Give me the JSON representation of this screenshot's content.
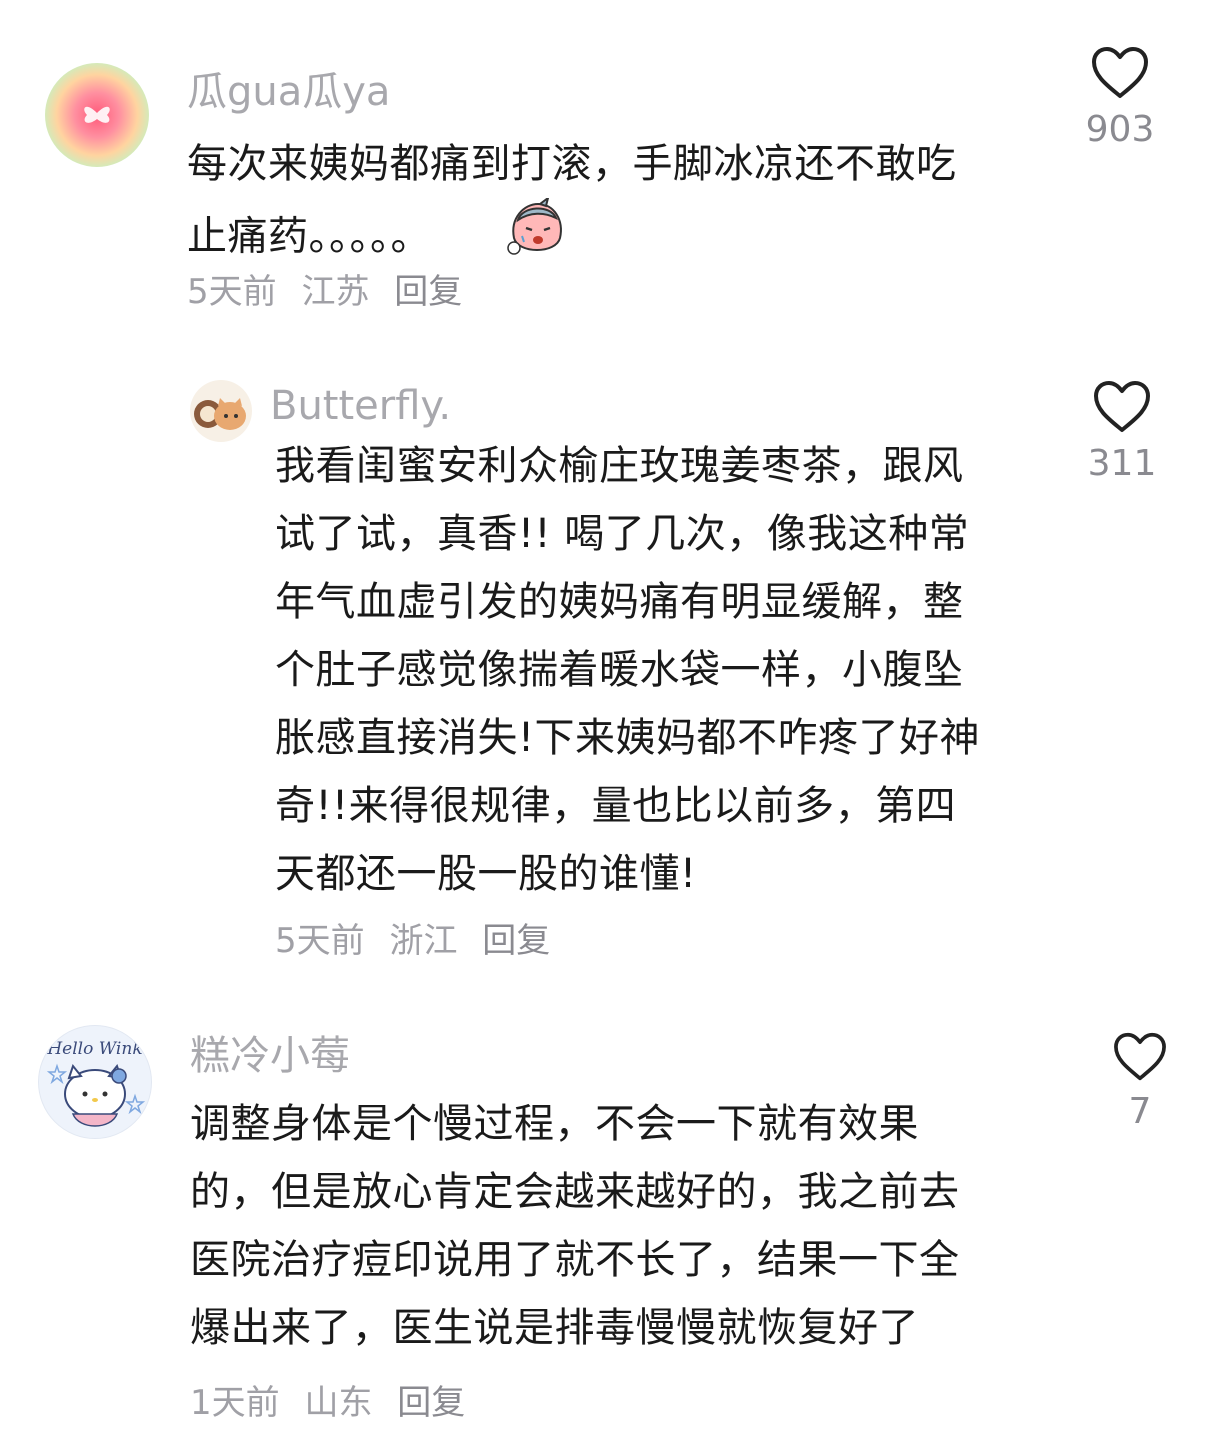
{
  "comments": [
    {
      "username": "瓜gua瓜ya",
      "text": "每次来姨妈都痛到打滚，手脚冰凉还不敢吃止痛药。。。。。",
      "line1": "每次来姨妈都痛到打滚，手脚冰凉还不敢吃",
      "line2": "止痛药。。。。。",
      "time": "5天前",
      "location": "江苏",
      "reply": "回复",
      "likes": "903"
    },
    {
      "username": "Butterfly.",
      "lines": [
        "我看闺蜜安利众榆庄玫瑰姜枣茶，跟风",
        "试了试，真香!! 喝了几次，像我这种常",
        "年气血虚引发的姨妈痛有明显缓解，整",
        "个肚子感觉像揣着暖水袋一样，小腹坠",
        "胀感直接消失!下来姨妈都不咋疼了好神",
        "奇!!来得很规律，量也比以前多，第四",
        "天都还一股一股的谁懂!"
      ],
      "time": "5天前",
      "location": "浙江",
      "reply": "回复",
      "likes": "311"
    },
    {
      "username": "糕冷小莓",
      "avatar_text": "Hello Wink",
      "lines": [
        "调整身体是个慢过程，不会一下就有效果",
        "的，但是放心肯定会越来越好的，我之前去",
        "医院治疗痘印说用了就不长了，结果一下全",
        "爆出来了，医生说是排毒慢慢就恢复好了"
      ],
      "time": "1天前",
      "location": "山东",
      "reply": "回复",
      "likes": "7"
    }
  ],
  "icons": {
    "like": "heart-outline-icon",
    "emoji": "crying-face-sticker-icon"
  },
  "colors": {
    "username": "#a8a8ad",
    "text": "#1a1a1a",
    "meta": "#a0a0a6"
  }
}
